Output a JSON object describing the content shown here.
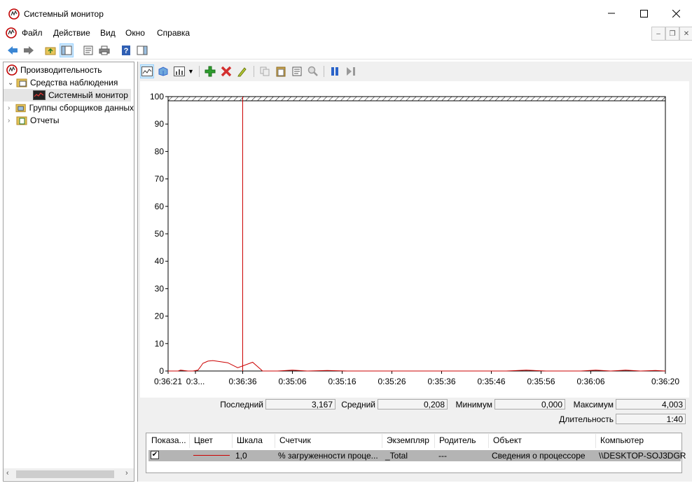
{
  "window": {
    "title": "Системный монитор",
    "controls": {
      "minimize": "—",
      "maximize": "☐",
      "close": "✕"
    }
  },
  "menu": {
    "items": [
      "Файл",
      "Действие",
      "Вид",
      "Окно",
      "Справка"
    ]
  },
  "tree": {
    "root": "Производительность",
    "items": [
      {
        "label": "Средства наблюдения",
        "expanded": true
      },
      {
        "label": "Системный монитор",
        "selected": true
      },
      {
        "label": "Группы сборщиков данных",
        "expanded": false
      },
      {
        "label": "Отчеты",
        "expanded": false
      }
    ]
  },
  "chart_data": {
    "type": "line",
    "ylim": [
      0,
      100
    ],
    "yticks": [
      "100",
      "90",
      "80",
      "70",
      "60",
      "50",
      "40",
      "30",
      "20",
      "10",
      "0"
    ],
    "xticks": [
      "0:36:21",
      "0:3...",
      "0:36:36",
      "0:35:06",
      "0:35:16",
      "0:35:26",
      "0:35:36",
      "0:35:46",
      "0:35:56",
      "0:36:06",
      "0:36:20"
    ],
    "series": [
      {
        "color": "#cc0000",
        "x": [
          0,
          0.5,
          2,
          2.5,
          4,
          5,
          6,
          6.5,
          7,
          7.5,
          8,
          9,
          12,
          14,
          17,
          19,
          22,
          25,
          28,
          32,
          36,
          40,
          44,
          48,
          52,
          56,
          60,
          64,
          68,
          72,
          76,
          80,
          83,
          86,
          89,
          92,
          95,
          98,
          100
        ],
        "y": [
          0,
          0,
          0,
          0.3,
          0,
          0,
          0.3,
          1.5,
          2.8,
          3.2,
          3.6,
          3.8,
          3.0,
          1.2,
          3.2,
          0,
          0,
          0.3,
          0,
          0.2,
          0,
          0,
          0,
          0,
          0,
          0,
          0,
          0,
          0,
          0.3,
          0,
          0,
          0,
          0.3,
          0,
          0.3,
          0,
          0.2,
          0
        ]
      }
    ],
    "marker_x": 15
  },
  "stats": {
    "last_label": "Последний",
    "last": "3,167",
    "avg_label": "Средний",
    "avg": "0,208",
    "min_label": "Минимум",
    "min": "0,000",
    "max_label": "Максимум",
    "max": "4,003",
    "duration_label": "Длительность",
    "duration": "1:40"
  },
  "counters": {
    "headers": [
      "Показа...",
      "Цвет",
      "Шкала",
      "Счетчик",
      "Экземпляр",
      "Родитель",
      "Объект",
      "Компьютер"
    ],
    "row": {
      "show": "✔",
      "scale": "1,0",
      "counter": "% загруженности проце...",
      "instance": "_Total",
      "parent": "---",
      "object": "Сведения о процессоре",
      "computer": "\\\\DESKTOP-SOJ3DGR",
      "color": "#cc0000"
    }
  },
  "colors": {
    "accent": "#cce8ff",
    "line": "#cc0000",
    "pane": "#f0f0f0"
  }
}
